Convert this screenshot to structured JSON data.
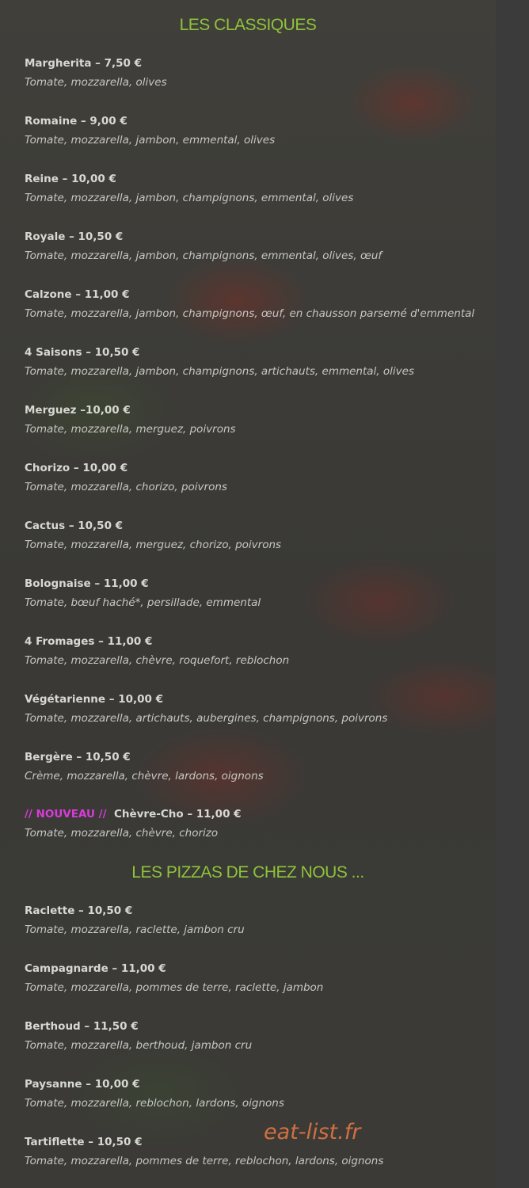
{
  "sections": [
    {
      "title": "LES CLASSIQUES",
      "items": [
        {
          "name": "Margherita – 7,50 €",
          "desc": "Tomate, mozzarella, olives"
        },
        {
          "name": "Romaine – 9,00 €",
          "desc": "Tomate, mozzarella, jambon, emmental, olives"
        },
        {
          "name": "Reine – 10,00 €",
          "desc": "Tomate, mozzarella, jambon, champignons, emmental, olives"
        },
        {
          "name": "Royale – 10,50 €",
          "desc": "Tomate, mozzarella, jambon, champignons, emmental, olives, œuf"
        },
        {
          "name": "Calzone – 11,00 €",
          "desc": "Tomate, mozzarella, jambon, champignons, œuf, en chausson parsemé d'emmental"
        },
        {
          "name": "4 Saisons – 10,50 €",
          "desc": "Tomate, mozzarella, jambon, champignons, artichauts, emmental, olives"
        },
        {
          "name": "Merguez –10,00 €",
          "desc": "Tomate, mozzarella, merguez, poivrons"
        },
        {
          "name": "Chorizo – 10,00 €",
          "desc": "Tomate, mozzarella, chorizo, poivrons"
        },
        {
          "name": "Cactus – 10,50 €",
          "desc": "Tomate, mozzarella, merguez, chorizo, poivrons"
        },
        {
          "name": "Bolognaise – 11,00 €",
          "desc": "Tomate, bœuf haché*, persillade, emmental"
        },
        {
          "name": "4 Fromages – 11,00 €",
          "desc": "Tomate, mozzarella, chèvre, roquefort, reblochon"
        },
        {
          "name": "Végétarienne – 10,00 €",
          "desc": "Tomate, mozzarella, artichauts, aubergines, champignons, poivrons"
        },
        {
          "name": "Bergère – 10,50 €",
          "desc": "Crème, mozzarella, chèvre, lardons, oignons"
        },
        {
          "badge": "// NOUVEAU //",
          "name": "Chèvre-Cho – 11,00 €",
          "desc": "Tomate, mozzarella, chèvre, chorizo"
        }
      ]
    },
    {
      "title": "LES PIZZAS DE CHEZ NOUS ...",
      "items": [
        {
          "name": "Raclette – 10,50 €",
          "desc": "Tomate, mozzarella, raclette, jambon cru"
        },
        {
          "name": "Campagnarde – 11,00 €",
          "desc": "Tomate, mozzarella, pommes de terre, raclette, jambon"
        },
        {
          "name": "Berthoud – 11,50 €",
          "desc": "Tomate, mozzarella, berthoud, jambon cru"
        },
        {
          "name": "Paysanne – 10,00 €",
          "desc": "Tomate, mozzarella, reblochon, lardons, oignons"
        },
        {
          "name": "Tartiflette – 10,50 €",
          "desc": "Tomate, mozzarella, pommes de terre, reblochon, lardons, oignons"
        }
      ]
    }
  ],
  "watermark": "eat-list.fr",
  "colors": {
    "heading": "#8fc43a",
    "badge": "#d93bd9",
    "watermark": "#d07040",
    "text": "#d8d8d3"
  }
}
